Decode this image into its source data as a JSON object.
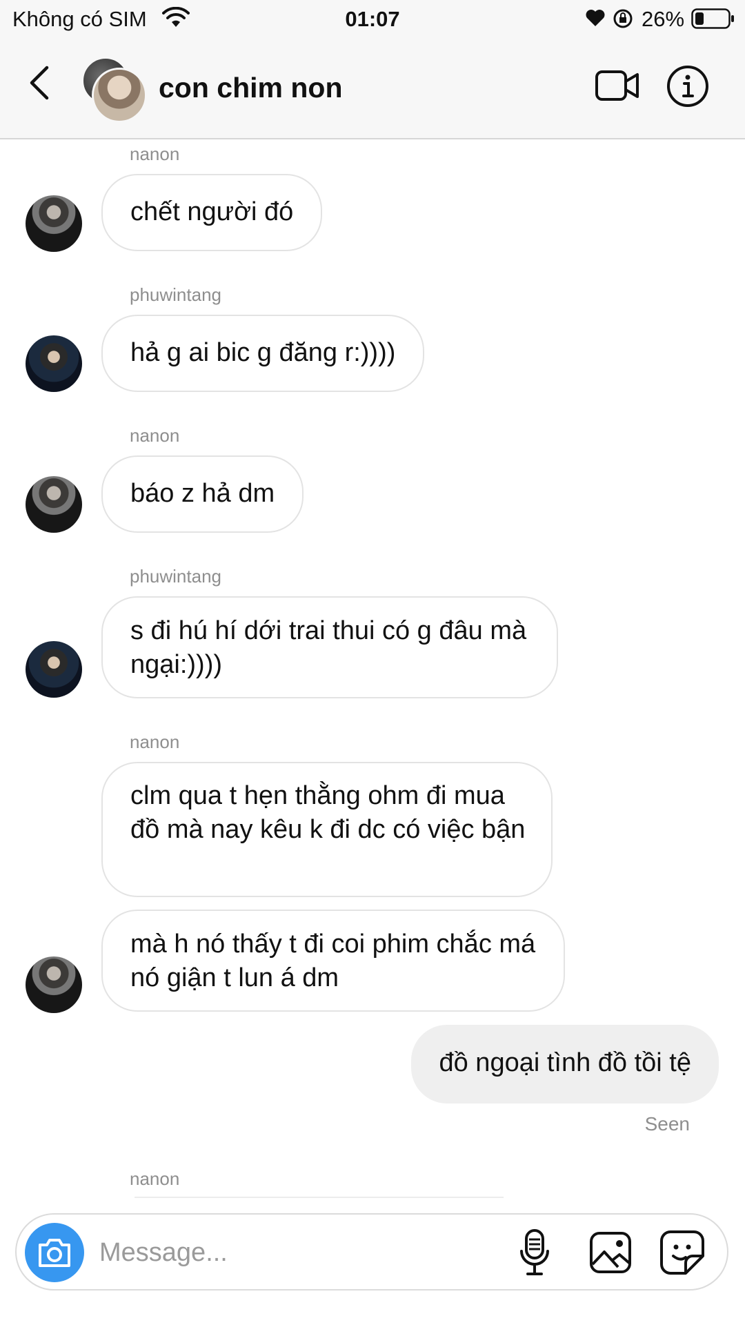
{
  "status_bar": {
    "carrier": "Không có SIM",
    "time": "01:07",
    "battery": "26%"
  },
  "header": {
    "title": "con chim non",
    "icons": [
      "back-chevron-icon",
      "video-call-icon",
      "info-icon"
    ]
  },
  "messages": [
    {
      "sender": "nanon",
      "text": "chết người đó"
    },
    {
      "sender": "phuwintang",
      "text": "hả g ai bic g đăng r:))))"
    },
    {
      "sender": "nanon",
      "text": "báo z hả dm"
    },
    {
      "sender": "phuwintang",
      "text": "s đi hú hí dới trai thui có g đâu mà ngại:))))"
    },
    {
      "sender": "nanon",
      "text": "clm qua t hẹn thằng ohm đi mua đồ mà nay kêu k đi dc có việc bận"
    },
    {
      "sender": "nanon",
      "text": "mà h nó thấy t đi coi phim chắc má nó giận t lun á dm"
    },
    {
      "sender": "me",
      "text": "đồ ngoại tình đồ tồi tệ"
    }
  ],
  "seen_label": "Seen",
  "last_sender": "nanon",
  "composer": {
    "placeholder": "Message...",
    "value": "",
    "icons": [
      "camera-icon",
      "microphone-icon",
      "gallery-icon",
      "sticker-icon"
    ]
  },
  "colors": {
    "accent": "#3797f0",
    "bubble_border": "#e3e3e3",
    "own_bubble": "#efefef",
    "secondary_text": "#8e8e8e"
  }
}
